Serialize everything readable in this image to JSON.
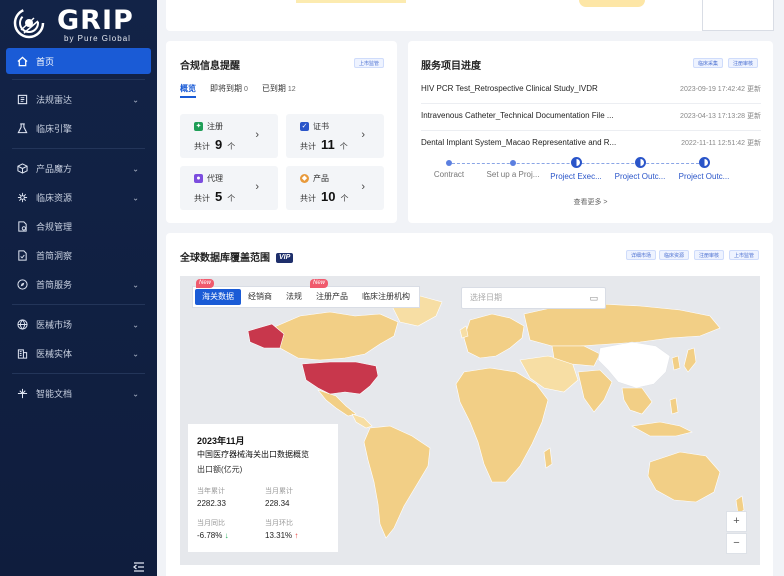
{
  "brand": {
    "name": "GRIP",
    "tagline": "by Pure Global"
  },
  "sidebar": {
    "items": [
      {
        "label": "首页",
        "icon": "home-icon",
        "active": true,
        "expandable": false
      },
      {
        "label": "法规雷达",
        "icon": "radar-icon",
        "expandable": true
      },
      {
        "label": "临床引擎",
        "icon": "flask-icon",
        "expandable": false
      },
      {
        "label": "产品魔方",
        "icon": "cube-icon",
        "expandable": true
      },
      {
        "label": "临床资源",
        "icon": "network-icon",
        "expandable": true
      },
      {
        "label": "合规管理",
        "icon": "document-check-icon",
        "expandable": false
      },
      {
        "label": "首简洞察",
        "icon": "insight-icon",
        "expandable": false
      },
      {
        "label": "首简服务",
        "icon": "compass-icon",
        "expandable": true
      },
      {
        "label": "医械市场",
        "icon": "globe-icon",
        "expandable": true
      },
      {
        "label": "医械实体",
        "icon": "building-icon",
        "expandable": true
      },
      {
        "label": "智能文档",
        "icon": "ai-document-icon",
        "expandable": true
      }
    ]
  },
  "compliance": {
    "title": "合规信息提醒",
    "action": "上市监管",
    "tabs": [
      {
        "label": "概览",
        "count": "",
        "active": true
      },
      {
        "label": "即将到期",
        "count": "0"
      },
      {
        "label": "已到期",
        "count": "12"
      }
    ],
    "tiles": [
      {
        "name": "注册",
        "prefix": "共计",
        "count": "9",
        "unit": "个",
        "icon": "pin-icon",
        "color": "#1f9e57"
      },
      {
        "name": "证书",
        "prefix": "共计",
        "count": "11",
        "unit": "个",
        "icon": "certificate-icon",
        "color": "#2a55c9"
      },
      {
        "name": "代理",
        "prefix": "共计",
        "count": "5",
        "unit": "个",
        "icon": "person-icon",
        "color": "#7c4dde"
      },
      {
        "name": "产品",
        "prefix": "共计",
        "count": "10",
        "unit": "个",
        "icon": "product-icon",
        "color": "#e89a3c"
      }
    ]
  },
  "service": {
    "title": "服务项目进度",
    "actions": [
      "临床采集",
      "注册审核"
    ],
    "rows": [
      {
        "name": "HIV PCR Test_Retrospective Clinical Study_IVDR",
        "date": "2023-09-19 17:42:42 更新"
      },
      {
        "name": "Intravenous Catheter_Technical Documentation File ...",
        "date": "2023-04-13 17:13:28 更新"
      },
      {
        "name": "Dental Implant System_Macao Representative and R...",
        "date": "2022-11-11 12:51:42 更新"
      }
    ],
    "steps": [
      {
        "label": "Contract",
        "state": "done"
      },
      {
        "label": "Set up a Proj...",
        "state": "done"
      },
      {
        "label": "Project Exec...",
        "state": "partial"
      },
      {
        "label": "Project Outc...",
        "state": "partial"
      },
      {
        "label": "Project Outc...",
        "state": "partial"
      }
    ],
    "more": "查看更多 >"
  },
  "global": {
    "title": "全球数据库覆盖范围",
    "vip": "VIP",
    "actions": [
      "详细市场",
      "临床资源",
      "注册审核",
      "上市监管"
    ],
    "tabs": [
      {
        "label": "海关数据",
        "active": true,
        "new": true
      },
      {
        "label": "经销商"
      },
      {
        "label": "法规"
      },
      {
        "label": "注册产品",
        "new": true
      },
      {
        "label": "临床注册机构"
      }
    ],
    "new_badge": "New",
    "date_placeholder": "选择日期",
    "panel": {
      "title": "2023年11月",
      "subtitle": "中国医疗器械海关出口数据概览",
      "unit": "出口额(亿元)",
      "stats": [
        {
          "label": "当年累计",
          "value": "2282.33"
        },
        {
          "label": "当月累计",
          "value": "228.34"
        },
        {
          "label": "当月同比",
          "value": "-6.78%",
          "trend": "down"
        },
        {
          "label": "当月环比",
          "value": "13.31%",
          "trend": "up"
        }
      ]
    },
    "zoom_in": "+",
    "zoom_out": "−",
    "colors": {
      "highlight": "#c8374c",
      "covered": "#f2cf86",
      "covered_light": "#f7dea4",
      "uncovered": "#ffffff",
      "ocean": "#e6e8ec"
    }
  }
}
